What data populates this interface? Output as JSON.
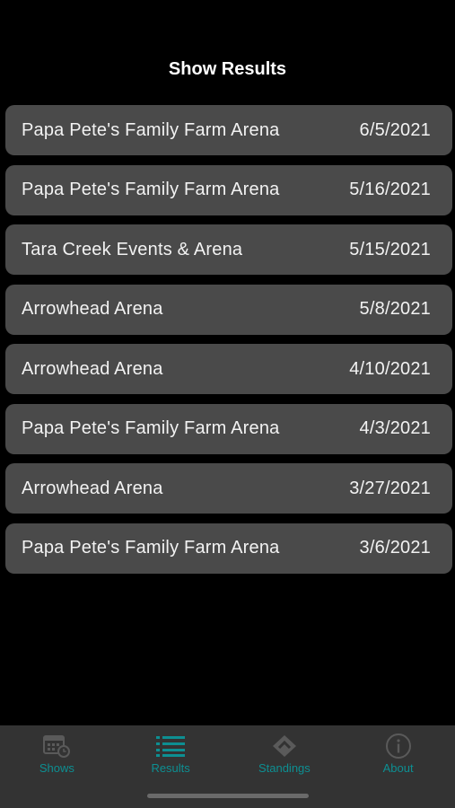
{
  "header": {
    "title": "Show Results"
  },
  "results": [
    {
      "venue": "Papa Pete's Family Farm Arena",
      "date": "6/5/2021"
    },
    {
      "venue": "Papa Pete's Family Farm Arena",
      "date": "5/16/2021"
    },
    {
      "venue": "Tara Creek Events & Arena",
      "date": "5/15/2021"
    },
    {
      "venue": "Arrowhead Arena",
      "date": "5/8/2021"
    },
    {
      "venue": "Arrowhead Arena",
      "date": "4/10/2021"
    },
    {
      "venue": "Papa Pete's Family Farm Arena",
      "date": "4/3/2021"
    },
    {
      "venue": "Arrowhead Arena",
      "date": "3/27/2021"
    },
    {
      "venue": "Papa Pete's Family Farm Arena",
      "date": "3/6/2021"
    }
  ],
  "tabbar": {
    "items": [
      {
        "label": "Shows",
        "icon": "calendar-clock-icon"
      },
      {
        "label": "Results",
        "icon": "list-icon"
      },
      {
        "label": "Standings",
        "icon": "diamond-arrow-icon"
      },
      {
        "label": "About",
        "icon": "info-icon"
      }
    ],
    "active": "Results",
    "accent_color": "#0d8f92",
    "inactive_color": "#5a5a5a"
  }
}
